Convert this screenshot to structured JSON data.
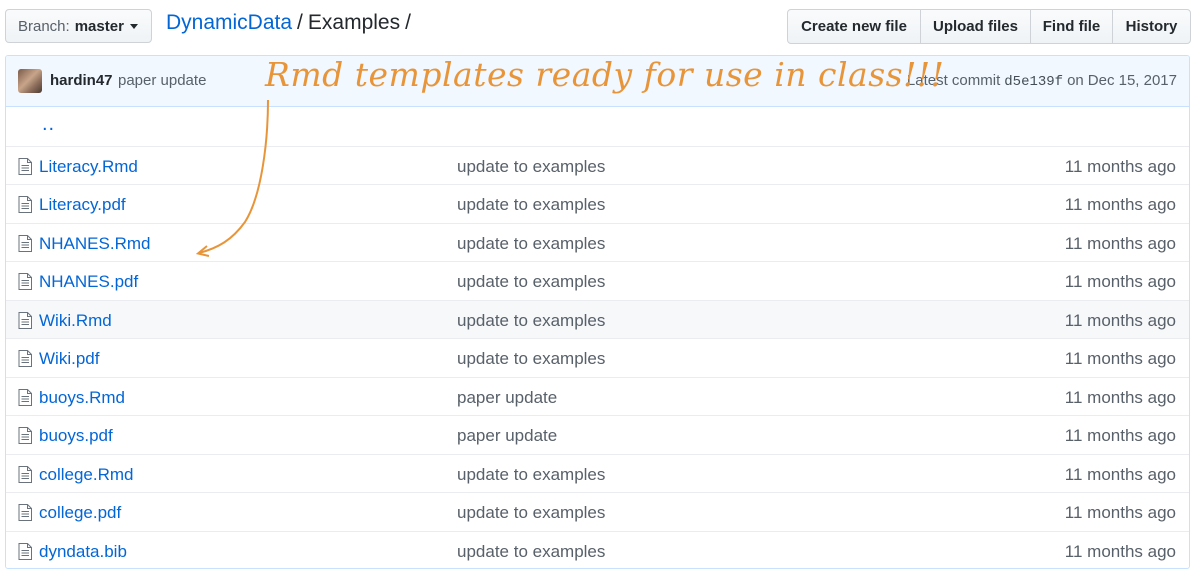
{
  "branch": {
    "label": "Branch:",
    "value": "master"
  },
  "breadcrumb": {
    "repo": "DynamicData",
    "separator": "/",
    "directory": "Examples",
    "trailing": "/"
  },
  "actions": {
    "create_new_file": "Create new file",
    "upload_files": "Upload files",
    "find_file": "Find file",
    "history": "History"
  },
  "commit": {
    "author": "hardin47",
    "message": "paper update",
    "latest_label": "Latest commit",
    "sha": "d5e139f",
    "date_prefix": "on",
    "date": "Dec 15, 2017"
  },
  "updir": "..",
  "files": [
    {
      "name": "Literacy.Rmd",
      "message": "update to examples",
      "age": "11 months ago"
    },
    {
      "name": "Literacy.pdf",
      "message": "update to examples",
      "age": "11 months ago"
    },
    {
      "name": "NHANES.Rmd",
      "message": "update to examples",
      "age": "11 months ago"
    },
    {
      "name": "NHANES.pdf",
      "message": "update to examples",
      "age": "11 months ago"
    },
    {
      "name": "Wiki.Rmd",
      "message": "update to examples",
      "age": "11 months ago"
    },
    {
      "name": "Wiki.pdf",
      "message": "update to examples",
      "age": "11 months ago"
    },
    {
      "name": "buoys.Rmd",
      "message": "paper update",
      "age": "11 months ago"
    },
    {
      "name": "buoys.pdf",
      "message": "paper update",
      "age": "11 months ago"
    },
    {
      "name": "college.Rmd",
      "message": "update to examples",
      "age": "11 months ago"
    },
    {
      "name": "college.pdf",
      "message": "update to examples",
      "age": "11 months ago"
    },
    {
      "name": "dyndata.bib",
      "message": "update to examples",
      "age": "11 months ago"
    }
  ],
  "annotation": {
    "text": "Rmd templates ready for use in class!!!",
    "color": "#e8953a"
  },
  "colors": {
    "link": "#0366d6",
    "commit_bar": "#f1f8ff",
    "row_highlight": "#f6f8fa"
  },
  "icons": {
    "file": "file-text-icon",
    "caret": "caret-down-icon"
  }
}
